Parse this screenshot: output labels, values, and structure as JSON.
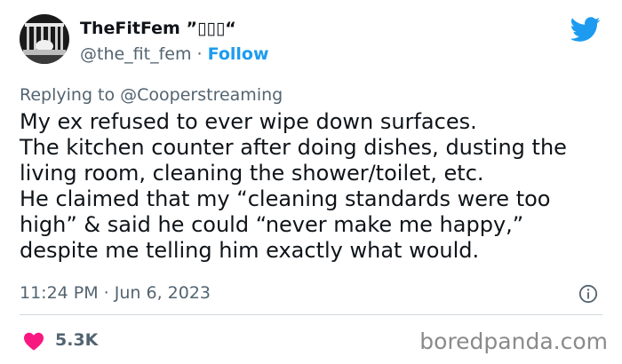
{
  "author": {
    "display_name": "TheFitFem ”▯▯▯“",
    "handle": "@the_fit_fem",
    "separator": " · ",
    "follow_label": "Follow"
  },
  "icons": {
    "avatar": "avatar-image",
    "brand": "twitter-bird-icon",
    "info": "info-icon",
    "like": "heart-icon"
  },
  "colors": {
    "link": "#1d9bf0",
    "secondary_text": "#536471",
    "heart": "#f91880",
    "twitter_blue": "#1d9bf0"
  },
  "reply": {
    "prefix": "Replying to ",
    "user": "@Cooperstreaming"
  },
  "tweet": {
    "lines": [
      "My ex refused to ever wipe down surfaces.",
      "The kitchen counter after doing dishes, dusting the",
      "living room, cleaning the shower/toilet, etc.",
      "He claimed that my “cleaning standards were too",
      "high” & said he could “never make me happy,”",
      "despite me telling him exactly what would."
    ],
    "timestamp": "11:24 PM · Jun 6, 2023",
    "like_count": "5.3K"
  },
  "watermark": "boredpanda.com"
}
